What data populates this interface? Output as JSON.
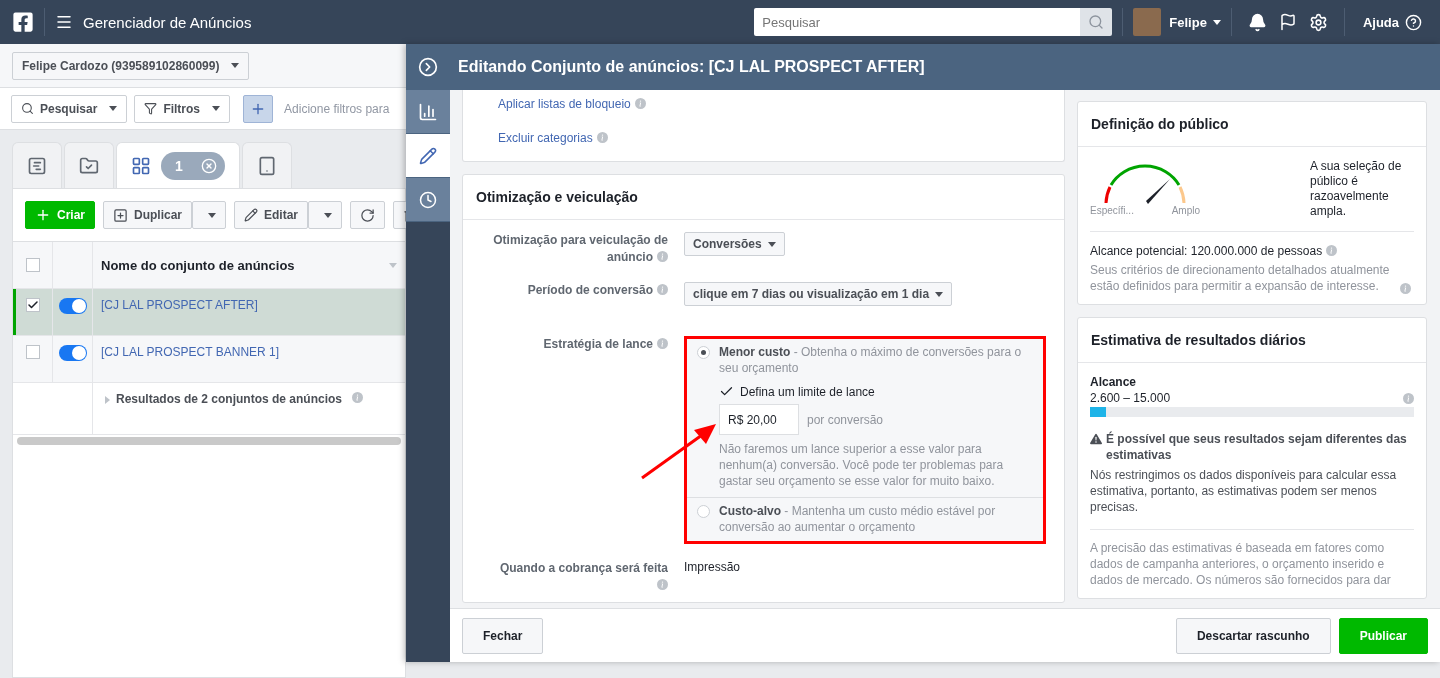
{
  "topbar": {
    "title": "Gerenciador de Anúncios",
    "search": {
      "placeholder": "Pesquisar"
    },
    "user": "Felipe",
    "help": "Ajuda"
  },
  "account": {
    "label": "Felipe Cardozo (939589102860099)"
  },
  "filters": {
    "search": "Pesquisar",
    "filters": "Filtros",
    "hint": "Adicione filtros para"
  },
  "level_tabs": [
    {
      "kind": "account",
      "selected": false
    },
    {
      "kind": "campaigns",
      "selected": false
    },
    {
      "kind": "adsets",
      "selected": true,
      "count": "1"
    },
    {
      "kind": "ads",
      "selected": false
    }
  ],
  "toolbar": {
    "create": "Criar",
    "duplicate": "Duplicar",
    "edit": "Editar"
  },
  "table": {
    "column": "Nome do conjunto de anúncios",
    "all_selected": false,
    "rows": [
      {
        "name": "[CJ LAL PROSPECT AFTER]",
        "selected": true,
        "on": true
      },
      {
        "name": "[CJ LAL PROSPECT BANNER 1]",
        "selected": false,
        "on": true
      }
    ],
    "summary": "Resultados de 2 conjuntos de anúncios"
  },
  "editor": {
    "title": "Editando Conjunto de anúncios: [CJ LAL PROSPECT AFTER]",
    "rail": [
      {
        "kind": "chart",
        "selected": false
      },
      {
        "kind": "edit",
        "selected": true
      },
      {
        "kind": "history",
        "selected": false
      }
    ],
    "links": [
      "Aplicar listas de bloqueio",
      "Excluir categorias"
    ],
    "section_title": "Otimização e veiculação",
    "fields": [
      {
        "kind": "dropdown",
        "label": "Otimização para veiculação de anúncio",
        "value": "Conversões"
      },
      {
        "kind": "dropdown",
        "label": "Período de conversão",
        "value": "clique em 7 dias ou visualização em 1 dia"
      },
      {
        "kind": "bid",
        "label": "Estratégia de lance"
      },
      {
        "kind": "text",
        "label": "Quando a cobrança será feita",
        "value": "Impressão"
      }
    ],
    "bid": {
      "options": [
        {
          "name": "Menor custo",
          "desc": "- Obtenha o máximo de conversões para o seu orçamento",
          "selected": true
        },
        {
          "name": "Custo-alvo",
          "desc": "- Mantenha um custo médio estável por conversão ao aumentar o orçamento",
          "selected": false
        }
      ],
      "cap": {
        "label": "Defina um limite de lance",
        "checked": true,
        "value": "R$ 20,00",
        "unit": "por conversão",
        "note": "Não faremos um lance superior a esse valor para nenhum(a) conversão. Você pode ter problemas para gastar seu orçamento se esse valor for muito baixo."
      }
    },
    "buttons": {
      "close": "Fechar",
      "discard": "Descartar rascunho",
      "publish": "Publicar"
    }
  },
  "audience": {
    "title": "Definição do público",
    "gauge_min": "Específi...",
    "gauge_max": "Amplo",
    "summary": "A sua seleção de público é razoavelmente ampla.",
    "reach": "Alcance potencial: 120.000.000 de pessoas",
    "note": "Seus critérios de direcionamento detalhados atualmente estão definidos para permitir a expansão de interesse."
  },
  "estimate": {
    "title": "Estimativa de resultados diários",
    "metric": "Alcance",
    "range": "2.600 – 15.000",
    "level": 0.05,
    "warning": "É possível que seus resultados sejam diferentes das estimativas",
    "warning_text": "Nós restringimos os dados disponíveis para calcular essa estimativa, portanto, as estimativas podem ser menos precisas.",
    "footnote": "A precisão das estimativas é baseada em fatores como dados de campanha anteriores, o orçamento inserido e dados de mercado. Os números são fornecidos para dar"
  }
}
